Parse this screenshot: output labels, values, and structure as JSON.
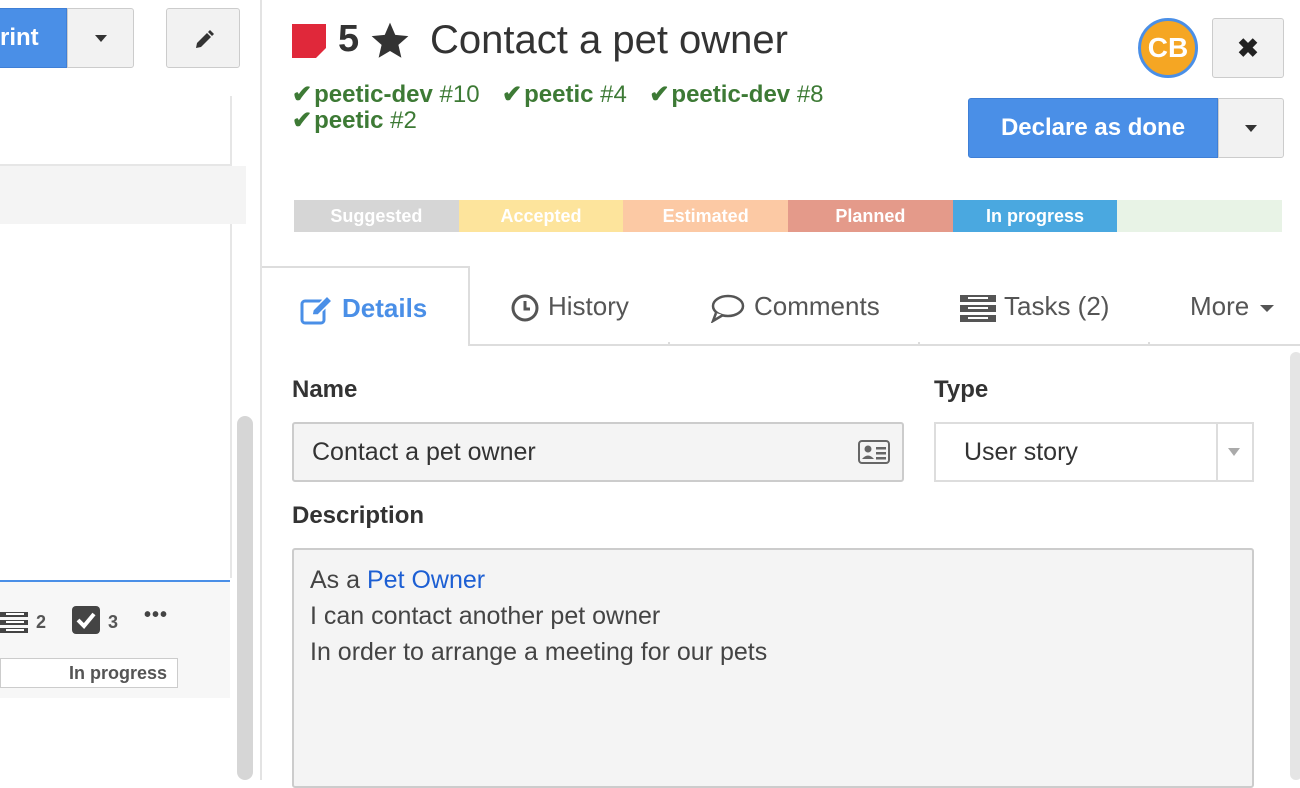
{
  "left_panel": {
    "sprint_button_label": "rint",
    "card": {
      "tasks_count": "2",
      "acceptance_count": "3",
      "more_label": "•••",
      "status": "In progress"
    }
  },
  "story": {
    "points": "5",
    "title": "Contact a pet owner",
    "flag_color": "#e0283a",
    "dependencies": [
      {
        "project": "peetic-dev",
        "number": "#10"
      },
      {
        "project": "peetic",
        "number": "#4"
      },
      {
        "project": "peetic-dev",
        "number": "#8"
      },
      {
        "project": "peetic",
        "number": "#2"
      }
    ]
  },
  "header": {
    "avatar_initials": "CB",
    "close_label": "✖",
    "declare_done_label": "Declare as done"
  },
  "states": [
    {
      "label": "Suggested",
      "color": "#d6d6d6"
    },
    {
      "label": "Accepted",
      "color": "#fde49c"
    },
    {
      "label": "Estimated",
      "color": "#fcc9a4"
    },
    {
      "label": "Planned",
      "color": "#e49a8a"
    },
    {
      "label": "In progress",
      "color": "#4aa8e0"
    },
    {
      "label": "",
      "color": "#e8f3e6"
    }
  ],
  "tabs": {
    "details": "Details",
    "history": "History",
    "comments": "Comments",
    "tasks": "Tasks (2)",
    "more": "More"
  },
  "form": {
    "name_label": "Name",
    "name_value": "Contact a pet owner",
    "type_label": "Type",
    "type_value": "User story",
    "description_label": "Description",
    "description": {
      "line1_prefix": "As a ",
      "line1_link": "Pet Owner",
      "line2": "I can contact another pet owner",
      "line3": "In order to arrange a meeting for our pets"
    }
  }
}
